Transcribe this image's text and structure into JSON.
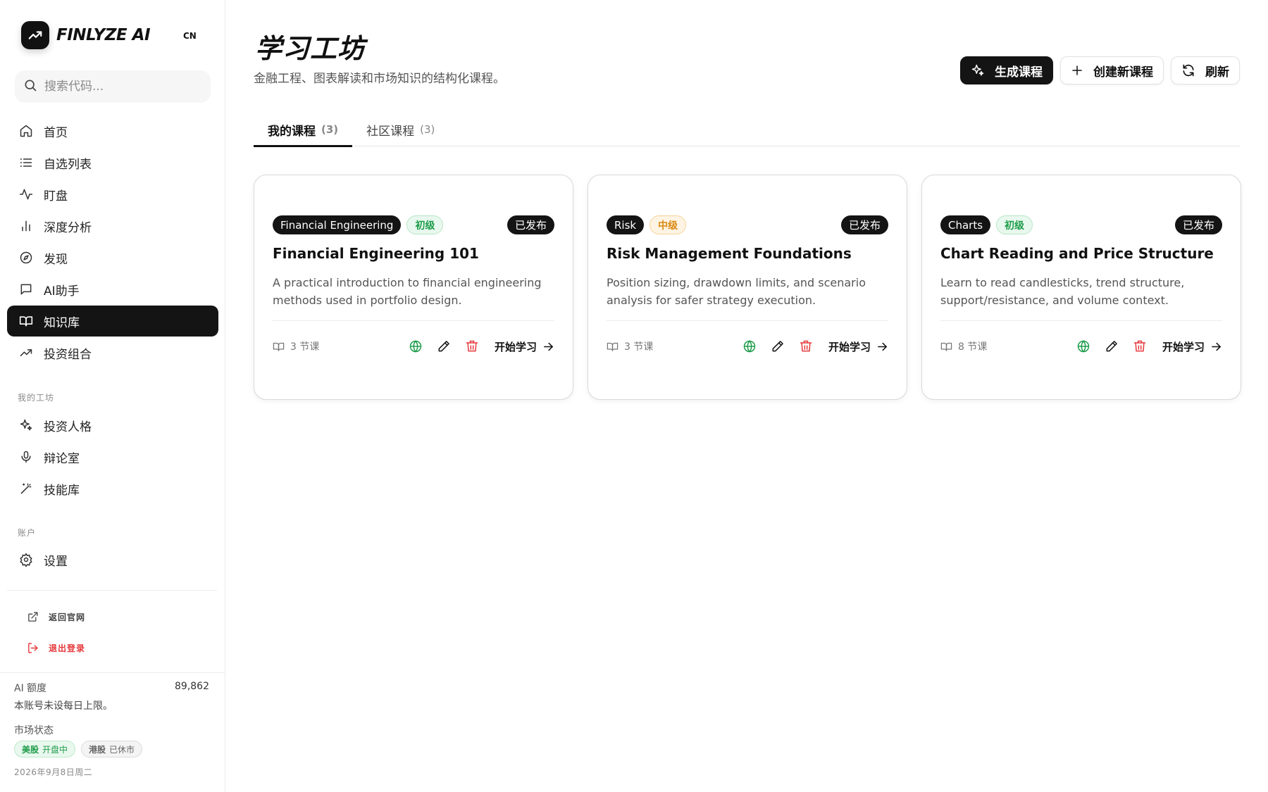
{
  "brand": {
    "name": "FINLYZE AI",
    "lang": "CN"
  },
  "search": {
    "placeholder": "搜索代码..."
  },
  "nav": {
    "main": [
      {
        "label": "首页",
        "icon": "home-icon"
      },
      {
        "label": "自选列表",
        "icon": "list-icon"
      },
      {
        "label": "盯盘",
        "icon": "activity-icon"
      },
      {
        "label": "深度分析",
        "icon": "bar-chart-icon"
      },
      {
        "label": "发现",
        "icon": "compass-icon"
      },
      {
        "label": "AI助手",
        "icon": "chat-icon"
      },
      {
        "label": "知识库",
        "icon": "book-icon",
        "active": true
      },
      {
        "label": "投资组合",
        "icon": "trending-up-icon"
      }
    ],
    "workshop_label": "我的工坊",
    "workshop": [
      {
        "label": "投资人格",
        "icon": "sparkles-icon"
      },
      {
        "label": "辩论室",
        "icon": "mic-icon"
      },
      {
        "label": "技能库",
        "icon": "wand-icon"
      }
    ],
    "account_label": "账户",
    "account": [
      {
        "label": "设置",
        "icon": "gear-icon"
      }
    ]
  },
  "footer": {
    "back_site": "返回官网",
    "logout": "退出登录",
    "quota_label": "AI 额度",
    "quota_value": "89,862",
    "quota_note": "本账号未设每日上限。",
    "market_label": "市场状态",
    "us_market": {
      "name": "美股",
      "status": "开盘中"
    },
    "hk_market": {
      "name": "港股",
      "status": "已休市"
    },
    "date": "2026年9月8日周二"
  },
  "page": {
    "title": "学习工坊",
    "subtitle": "金融工程、图表解读和市场知识的结构化课程。"
  },
  "actions": {
    "generate": "生成课程",
    "create": "创建新课程",
    "refresh": "刷新"
  },
  "tabs": [
    {
      "label": "我的课程",
      "count": "(3)",
      "active": true
    },
    {
      "label": "社区课程",
      "count": "(3)",
      "active": false
    }
  ],
  "colors": {
    "accent": "#141414",
    "success": "#1f9d4b",
    "warning": "#d98a12",
    "danger": "#e5383b"
  },
  "courses": [
    {
      "category": "Financial Engineering",
      "level": "初级",
      "level_type": "beginner",
      "status": "已发布",
      "title": "Financial Engineering 101",
      "description": "A practical introduction to financial engineering methods used in portfolio design.",
      "lessons": "3 节课",
      "start": "开始学习"
    },
    {
      "category": "Risk",
      "level": "中级",
      "level_type": "mid",
      "status": "已发布",
      "title": "Risk Management Foundations",
      "description": "Position sizing, drawdown limits, and scenario analysis for safer strategy execution.",
      "lessons": "3 节课",
      "start": "开始学习"
    },
    {
      "category": "Charts",
      "level": "初级",
      "level_type": "beginner",
      "status": "已发布",
      "title": "Chart Reading and Price Structure",
      "description": "Learn to read candlesticks, trend structure, support/resistance, and volume context.",
      "lessons": "8 节课",
      "start": "开始学习"
    }
  ]
}
